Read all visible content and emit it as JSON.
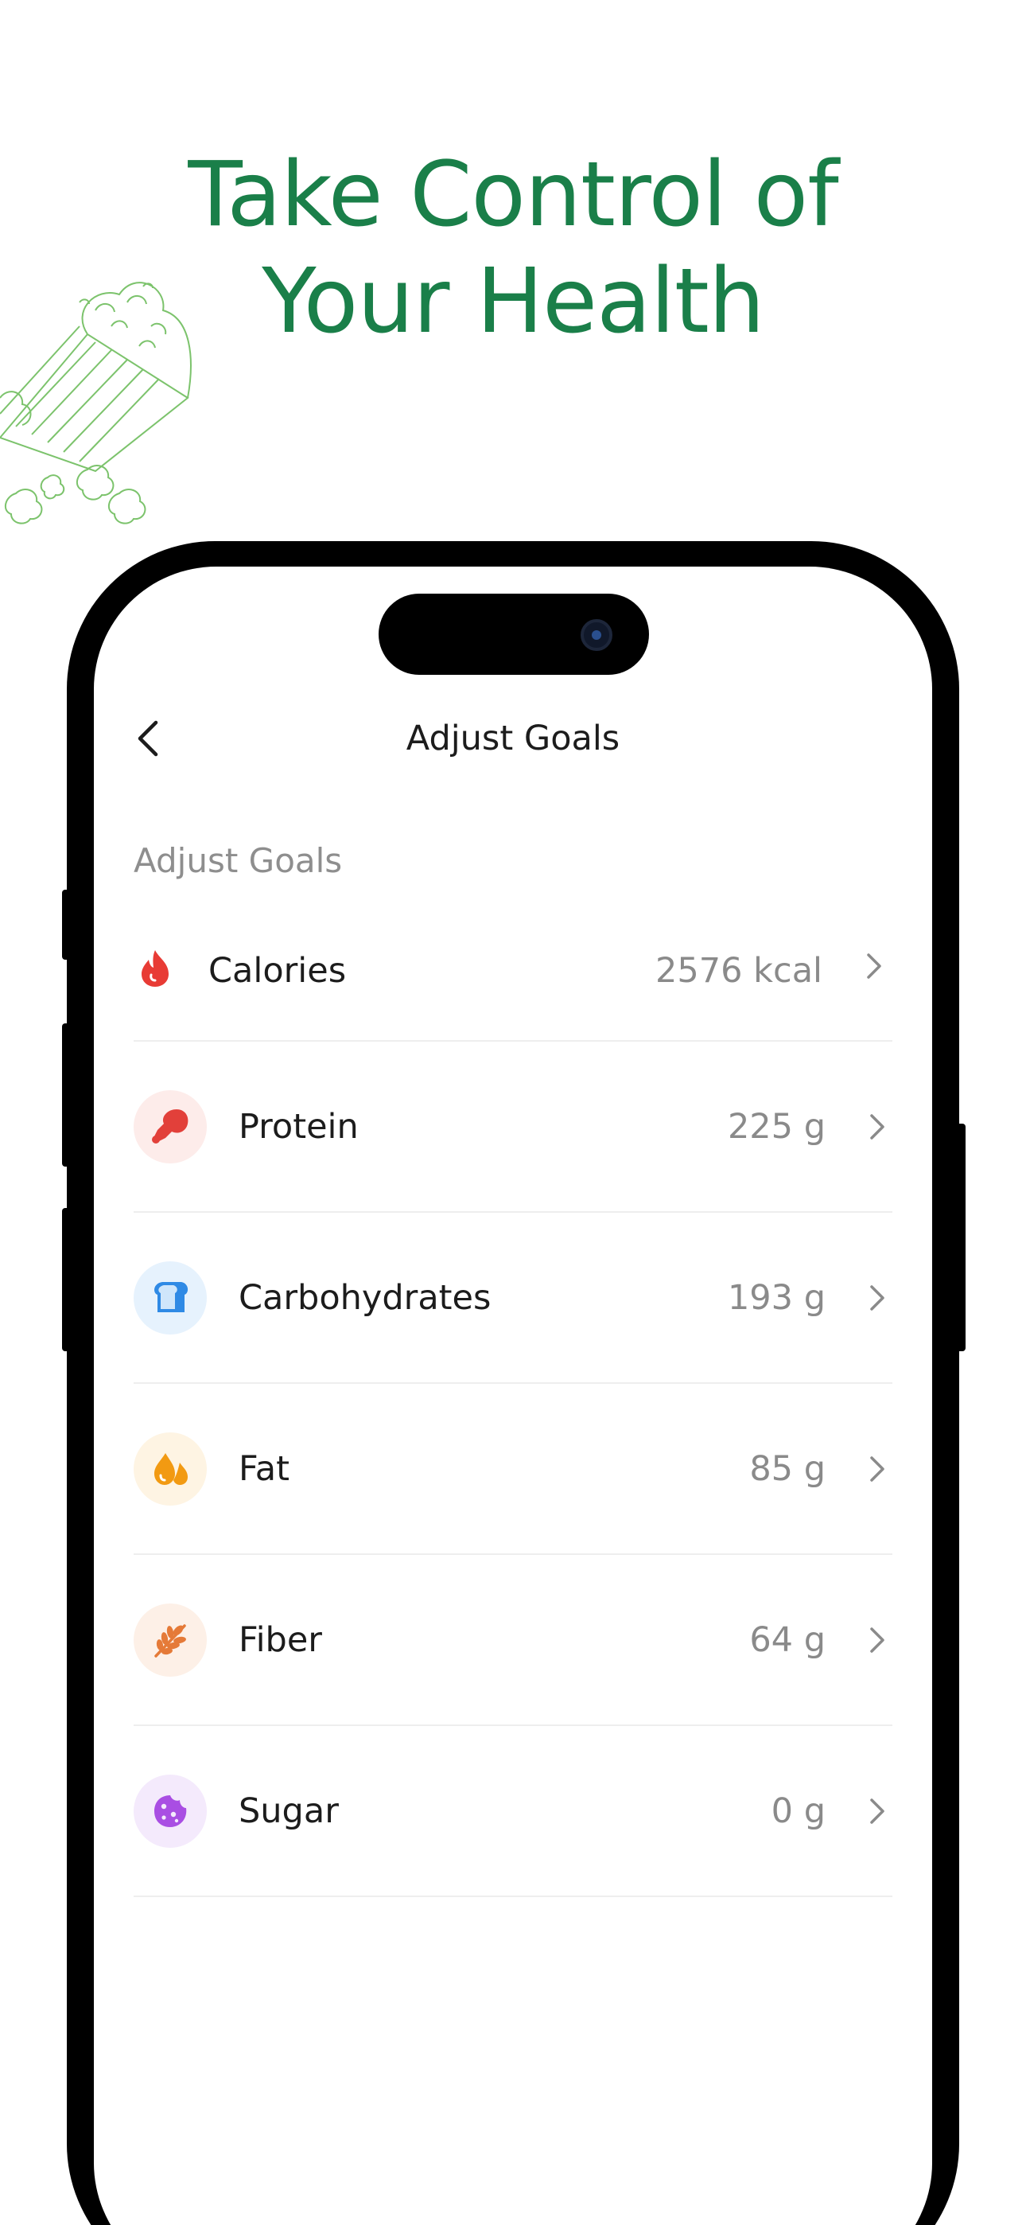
{
  "headline": {
    "line1": "Take Control of",
    "line2": "Your Health"
  },
  "nav": {
    "title": "Adjust Goals",
    "back_icon": "chevron-left-icon"
  },
  "section_label": "Adjust Goals",
  "goals": [
    {
      "id": "calories",
      "label": "Calories",
      "value": "2576 kcal",
      "icon": "flame-icon",
      "icon_color": "#e83b35",
      "bg_color": "#ffffff"
    },
    {
      "id": "protein",
      "label": "Protein",
      "value": "225 g",
      "icon": "drumstick-icon",
      "icon_color": "#e2403a",
      "bg_color": "#fdecea"
    },
    {
      "id": "carbohydrates",
      "label": "Carbohydrates",
      "value": "193 g",
      "icon": "bread-icon",
      "icon_color": "#2f8ae5",
      "bg_color": "#e6f2fd"
    },
    {
      "id": "fat",
      "label": "Fat",
      "value": "85 g",
      "icon": "oil-drops-icon",
      "icon_color": "#f29a12",
      "bg_color": "#fef4e3"
    },
    {
      "id": "fiber",
      "label": "Fiber",
      "value": "64 g",
      "icon": "wheat-icon",
      "icon_color": "#e57a38",
      "bg_color": "#fdf0e7"
    },
    {
      "id": "sugar",
      "label": "Sugar",
      "value": "0 g",
      "icon": "cookie-icon",
      "icon_color": "#a94ee3",
      "bg_color": "#f4eafc"
    }
  ],
  "colors": {
    "brand_green": "#1a7f49",
    "value_gray": "#8a8a8a",
    "divider": "#eeeeee"
  }
}
